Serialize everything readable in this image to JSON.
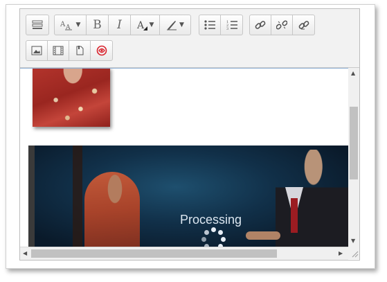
{
  "toolbar": {
    "row1": {
      "group1": [
        {
          "icon": "toolbar-toggle-icon"
        }
      ],
      "group2": [
        {
          "icon": "font-size-icon",
          "dropdown": true
        },
        {
          "label": "B",
          "icon": "bold-icon"
        },
        {
          "label": "I",
          "icon": "italic-icon"
        },
        {
          "icon": "font-color-icon",
          "dropdown": true
        },
        {
          "icon": "background-color-icon",
          "dropdown": true
        }
      ],
      "group3": [
        {
          "icon": "bullet-list-icon"
        },
        {
          "icon": "numbered-list-icon"
        }
      ],
      "group4": [
        {
          "icon": "link-icon"
        },
        {
          "icon": "unlink-icon"
        },
        {
          "icon": "auto-link-icon"
        }
      ]
    },
    "row2": {
      "group1": [
        {
          "icon": "image-icon"
        },
        {
          "icon": "media-icon"
        },
        {
          "icon": "file-manager-icon"
        },
        {
          "icon": "recordrtc-icon"
        }
      ]
    }
  },
  "content": {
    "processing_text": "Processing"
  },
  "colors": {
    "toolbar_bg": "#f2f2f2",
    "border": "#c6c6c6",
    "recordrtc_red": "#d9232d"
  }
}
